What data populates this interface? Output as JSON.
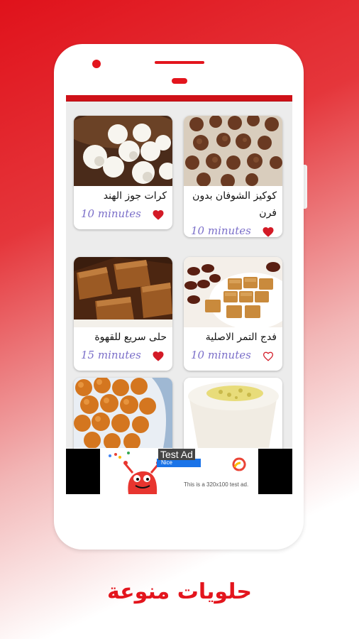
{
  "colors": {
    "accent": "#e3151d",
    "time_text": "#7b6fc9"
  },
  "recipes": [
    {
      "title": "كوكيز الشوفان بدون فرن",
      "time": "10 minutes",
      "favorite": true
    },
    {
      "title": "كرات جوز الهند",
      "time": "10 minutes",
      "favorite": true
    },
    {
      "title": "فدج التمر الاصلية",
      "time": "10 minutes",
      "favorite": false
    },
    {
      "title": "حلى سريع للقهوة",
      "time": "15 minutes",
      "favorite": true
    },
    {
      "title": "",
      "time": "",
      "favorite": false
    },
    {
      "title": "",
      "time": "",
      "favorite": false
    }
  ],
  "ad": {
    "label": "Test Ad",
    "subtext": "This is a 320x100 test ad.",
    "brand_word": "Nice"
  },
  "caption": "حلويات منوعة"
}
